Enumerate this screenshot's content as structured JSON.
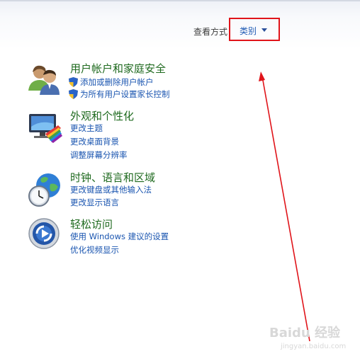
{
  "header": {
    "view_by_label": "查看方式",
    "view_value": "类别"
  },
  "categories": [
    {
      "title": "用户帐户和家庭安全",
      "icon": "users-icon",
      "links": [
        "添加或删除用户帐户",
        "为所有用户设置家长控制"
      ]
    },
    {
      "title": "外观和个性化",
      "icon": "display-color-icon",
      "links": [
        "更改主题",
        "更改桌面背景",
        "调整屏幕分辨率"
      ]
    },
    {
      "title": "时钟、语言和区域",
      "icon": "globe-clock-icon",
      "links": [
        "更改键盘或其他输入法",
        "更改显示语言"
      ]
    },
    {
      "title": "轻松访问",
      "icon": "ease-of-access-icon",
      "links": [
        "使用 Windows 建议的设置",
        "优化视频显示"
      ]
    }
  ],
  "annotation": {
    "highlight_color": "#e0141a"
  },
  "watermark": {
    "text": "Baidu 经验",
    "sub": "jingyan.baidu.com"
  }
}
